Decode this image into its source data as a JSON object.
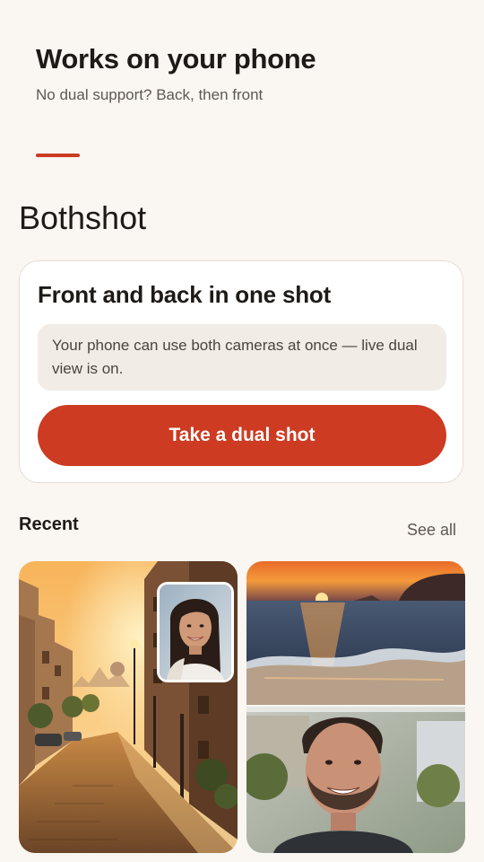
{
  "header": {
    "title": "Works on your phone",
    "subtitle": "No dual support? Back, then front"
  },
  "app": {
    "name": "Bothshot"
  },
  "dual_card": {
    "title": "Front and back in one shot",
    "status_message": "Your phone can use both cameras at once — live dual view is on.",
    "button_label": "Take a dual shot"
  },
  "recent": {
    "title": "Recent",
    "see_all_label": "See all",
    "items": [
      {
        "description": "street-sunset-with-selfie-inset"
      },
      {
        "description": "beach-sunset-over-selfie"
      }
    ]
  },
  "colors": {
    "accent": "#cc3b22",
    "background": "#faf6f1",
    "card": "#ffffff",
    "status_box": "#f1ece6"
  }
}
